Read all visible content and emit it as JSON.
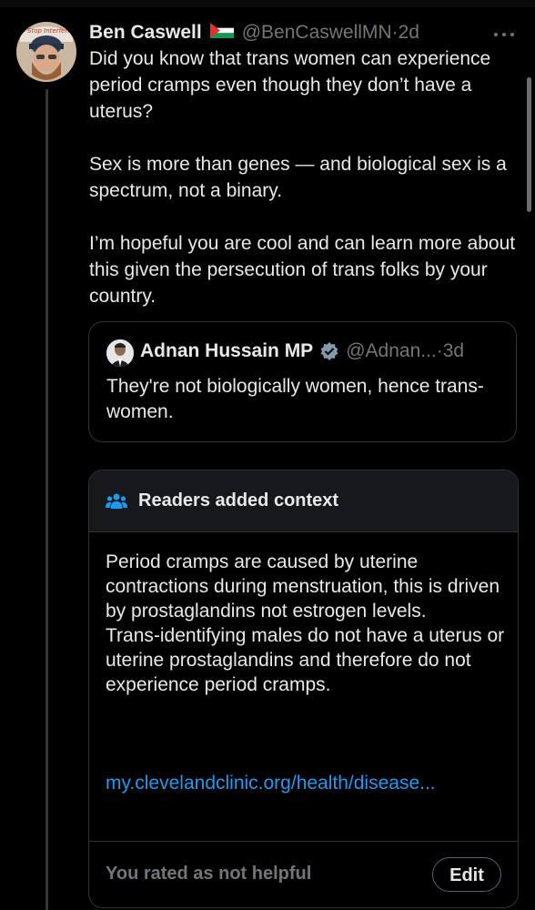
{
  "tweet": {
    "author_name": "Ben Caswell",
    "author_handle": "@BenCaswellMN",
    "separator": "·",
    "age": "2d",
    "paragraphs": [
      "Did you know that trans women can experience period cramps even though they don’t have a uterus?",
      "Sex is more than genes — and biological sex is a spectrum, not a binary.",
      "I’m hopeful you are cool and can learn more about this given the persecution of trans folks by your country."
    ],
    "more_icon": "more-dots-icon",
    "flag_icon": "palestine-flag-icon"
  },
  "quote": {
    "author_name": "Adnan Hussain MP",
    "author_handle": "@Adnan...",
    "separator": "·",
    "age": "3d",
    "text": "They're not biologically women, hence trans-women.",
    "verified_icon": "verified-badge-icon"
  },
  "note": {
    "title": "Readers added context",
    "icon": "people-icon",
    "paragraphs": [
      "Period cramps are caused by uterine contractions during menstruation, this is driven by prostaglandins not estrogen levels.",
      "Trans-identifying males do not have a uterus or uterine prostaglandins and therefore do not experience period cramps."
    ],
    "link": "my.clevelandclinic.org/health/disease...",
    "rating_text": "You rated as not helpful",
    "edit_label": "Edit"
  },
  "colors": {
    "background": "#000000",
    "text": "#e7e9ea",
    "muted": "#71767b",
    "link": "#1d9bf0",
    "border": "#2f3336"
  }
}
